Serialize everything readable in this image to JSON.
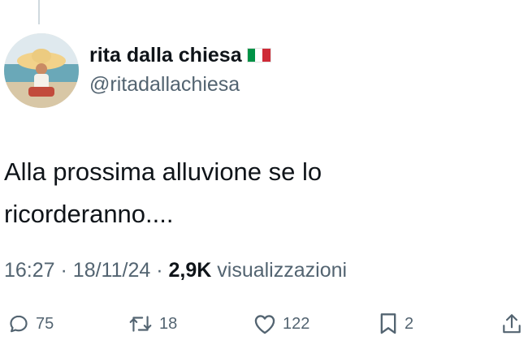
{
  "author": {
    "display_name": "rita dalla chiesa",
    "handle": "@ritadallachiesa",
    "flag_icon": "italy-flag-icon",
    "flag_colors": [
      "#009246",
      "#ffffff",
      "#ce2b37"
    ]
  },
  "tweet": {
    "text": "Alla prossima alluvione se lo ricorderanno...."
  },
  "meta": {
    "time": "16:27",
    "separator": "·",
    "date": "18/11/24",
    "views_count": "2,9K",
    "views_label": "visualizzazioni"
  },
  "actions": {
    "reply": {
      "icon": "reply-icon",
      "count": "75"
    },
    "repost": {
      "icon": "repost-icon",
      "count": "18"
    },
    "like": {
      "icon": "heart-icon",
      "count": "122"
    },
    "bookmark": {
      "icon": "bookmark-icon",
      "count": "2"
    },
    "share": {
      "icon": "share-icon"
    }
  },
  "colors": {
    "text_primary": "#0f1419",
    "text_secondary": "#536471",
    "thread_line": "#cfd9de"
  }
}
